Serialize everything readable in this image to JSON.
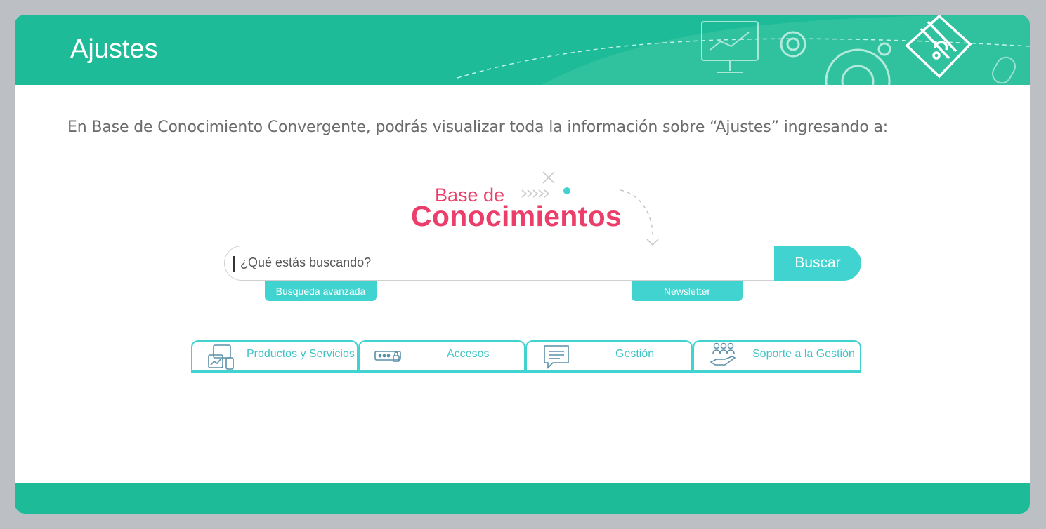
{
  "header": {
    "title": "Ajustes"
  },
  "intro": "En Base de Conocimiento Convergente, podrás visualizar toda la información sobre “Ajustes” ingresando a:",
  "logo": {
    "line1": "Base de",
    "line2": "Conocimientos"
  },
  "search": {
    "placeholder": "¿Qué estás buscando?",
    "button": "Buscar"
  },
  "links": {
    "advanced": "Búsqueda avanzada",
    "newsletter": "Newsletter"
  },
  "tabs": [
    {
      "label": "Productos y Servicios",
      "icon": "devices-icon"
    },
    {
      "label": "Accesos",
      "icon": "password-icon"
    },
    {
      "label": "Gestión",
      "icon": "chat-icon"
    },
    {
      "label": "Soporte a la Gestión",
      "icon": "team-support-icon"
    }
  ],
  "colors": {
    "header": "#1dbb98",
    "accent": "#41d3d0",
    "brand": "#ec3e6b"
  }
}
